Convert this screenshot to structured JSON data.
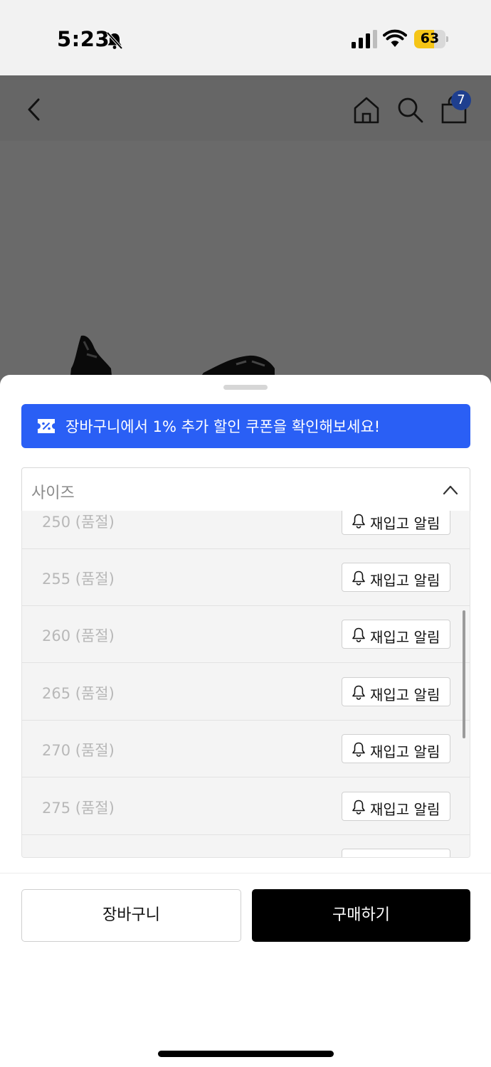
{
  "status_bar": {
    "time": "5:23",
    "battery": "63",
    "battery_level": 0.63
  },
  "header": {
    "cart_count": "7"
  },
  "coupon": {
    "text": "장바구니에서 1% 추가 할인 쿠폰을 확인해보세요!"
  },
  "size_select": {
    "label": "사이즈"
  },
  "sizes": [
    {
      "label": "250 (품절)",
      "action": "재입고 알림"
    },
    {
      "label": "255 (품절)",
      "action": "재입고 알림"
    },
    {
      "label": "260 (품절)",
      "action": "재입고 알림"
    },
    {
      "label": "265 (품절)",
      "action": "재입고 알림"
    },
    {
      "label": "270 (품절)",
      "action": "재입고 알림"
    },
    {
      "label": "275 (품절)",
      "action": "재입고 알림"
    }
  ],
  "actions": {
    "cart": "장바구니",
    "buy": "구매하기"
  },
  "icons": {
    "back": "chevron-left-icon",
    "home": "home-icon",
    "search": "search-icon",
    "cart": "shopping-bag-icon",
    "coupon": "coupon-icon",
    "bell": "bell-icon"
  },
  "colors": {
    "accent": "#2a5ff5",
    "buy": "#000000",
    "battery": "#f5c517"
  }
}
